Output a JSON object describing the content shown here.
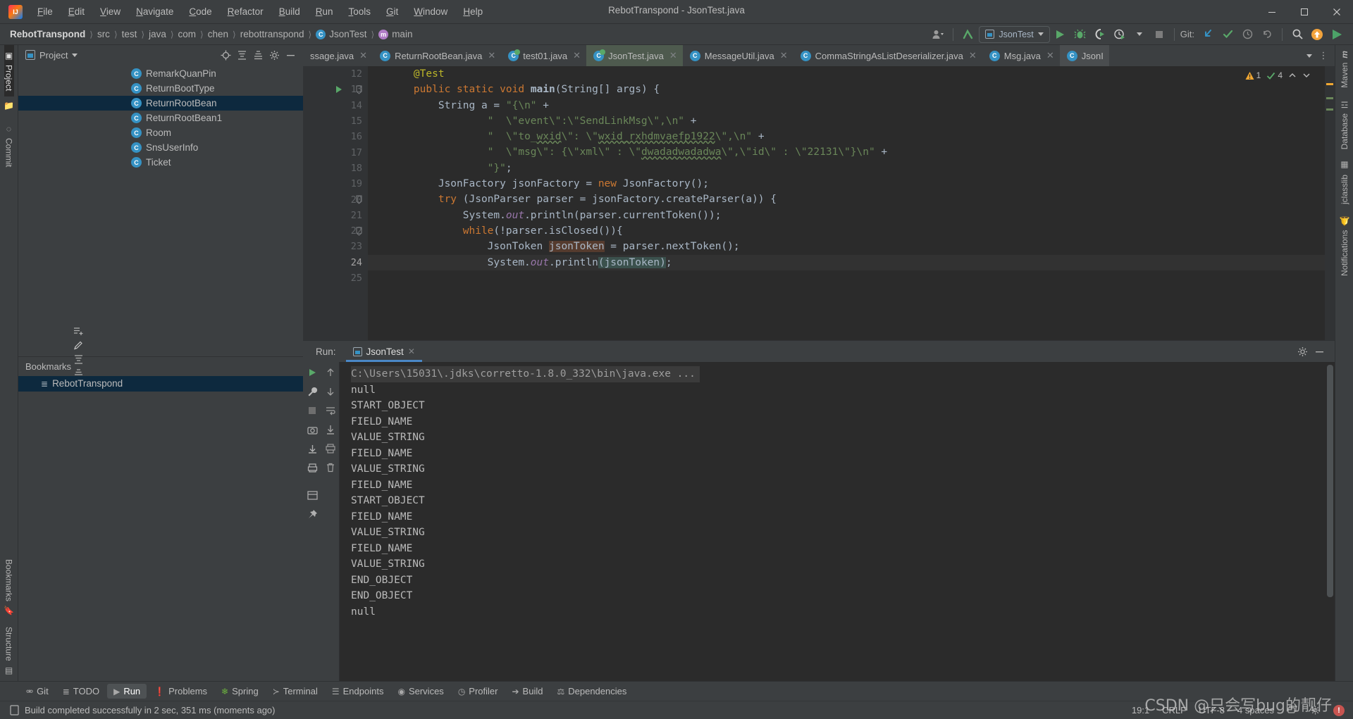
{
  "window": {
    "title": "RebotTranspond - JsonTest.java",
    "logo_icon": "intellij-idea-logo",
    "minimize_icon": "minimize-icon",
    "maximize_icon": "maximize-icon",
    "close_icon": "close-icon"
  },
  "menu": [
    {
      "label": "File",
      "mnemonic": "F"
    },
    {
      "label": "Edit",
      "mnemonic": "E"
    },
    {
      "label": "View",
      "mnemonic": "V"
    },
    {
      "label": "Navigate",
      "mnemonic": "N"
    },
    {
      "label": "Code",
      "mnemonic": "C"
    },
    {
      "label": "Refactor",
      "mnemonic": "R"
    },
    {
      "label": "Build",
      "mnemonic": "B"
    },
    {
      "label": "Run",
      "mnemonic": "R"
    },
    {
      "label": "Tools",
      "mnemonic": "T"
    },
    {
      "label": "Git",
      "mnemonic": "G"
    },
    {
      "label": "Window",
      "mnemonic": "W"
    },
    {
      "label": "Help",
      "mnemonic": "H"
    }
  ],
  "breadcrumb": [
    {
      "label": "RebotTranspond",
      "bold": true,
      "icon": ""
    },
    {
      "label": "src",
      "bold": false,
      "icon": ""
    },
    {
      "label": "test",
      "bold": false,
      "icon": ""
    },
    {
      "label": "java",
      "bold": false,
      "icon": ""
    },
    {
      "label": "com",
      "bold": false,
      "icon": ""
    },
    {
      "label": "chen",
      "bold": false,
      "icon": ""
    },
    {
      "label": "rebottranspond",
      "bold": false,
      "icon": ""
    },
    {
      "label": "JsonTest",
      "bold": false,
      "icon": "class-icon"
    },
    {
      "label": "main",
      "bold": false,
      "icon": "method-icon"
    }
  ],
  "toolbar": {
    "account_icon": "user-account-icon",
    "updates_icon": "update-arrow-icon",
    "run_config": "JsonTest",
    "run_config_icon": "application-config-icon",
    "run_icon": "run-icon",
    "debug_icon": "debug-bug-icon",
    "coverage_icon": "run-with-coverage-icon",
    "profiler_icon": "profiler-icon",
    "stop_icon": "stop-icon",
    "git_label": "Git:",
    "git_update_icon": "git-update-project-icon",
    "git_commit_icon": "git-commit-checkmark-icon",
    "git_history_icon": "git-history-clock-icon",
    "git_rollback_icon": "git-rollback-icon",
    "search_icon": "search-everywhere-icon",
    "notification_icon": "ide-update-icon",
    "run_anything_icon": "run-anything-icon"
  },
  "left_stripe": [
    {
      "label": "Project",
      "icon": "project-icon",
      "active": true
    },
    {
      "label": "",
      "icon": "folder-icon",
      "active": false
    },
    {
      "label": "Commit",
      "icon": "commit-icon",
      "active": false
    },
    {
      "label": "Bookmarks",
      "icon": "bookmarks-icon",
      "active": false
    },
    {
      "label": "Structure",
      "icon": "structure-icon",
      "active": false
    }
  ],
  "right_stripe": [
    {
      "label": "Maven",
      "icon": "maven-icon"
    },
    {
      "label": "Database",
      "icon": "database-icon"
    },
    {
      "label": "jclasslib",
      "icon": "jclasslib-icon"
    },
    {
      "label": "Notifications",
      "icon": "notifications-bell-icon"
    }
  ],
  "project_panel": {
    "title": "Project",
    "title_icon": "project-view-icon",
    "dropdown_icon": "chevron-down-icon",
    "actions": [
      "locate-icon",
      "expand-all-icon",
      "collapse-all-icon",
      "settings-gear-icon",
      "hide-icon"
    ],
    "tree_items": [
      {
        "label": "RemarkQuanPin",
        "icon": "java-class-icon",
        "selected": false
      },
      {
        "label": "ReturnBootType",
        "icon": "java-class-icon",
        "selected": false
      },
      {
        "label": "ReturnRootBean",
        "icon": "java-class-icon",
        "selected": true
      },
      {
        "label": "ReturnRootBean1",
        "icon": "java-class-icon",
        "selected": false
      },
      {
        "label": "Room",
        "icon": "java-class-icon",
        "selected": false
      },
      {
        "label": "SnsUserInfo",
        "icon": "java-class-icon",
        "selected": false
      },
      {
        "label": "Ticket",
        "icon": "java-class-icon",
        "selected": false
      }
    ]
  },
  "bookmarks_panel": {
    "title": "Bookmarks",
    "actions": [
      "add-bookmark-icon",
      "edit-icon",
      "expand-all-icon",
      "collapse-all-icon",
      "hide-icon"
    ],
    "items": [
      {
        "label": "RebotTranspond",
        "icon": "bookmark-list-icon",
        "selected": true
      }
    ]
  },
  "editor_tabs": [
    {
      "label": "ssage.java",
      "icon": "java-class-icon",
      "state": "normal",
      "close_icon": "close-tab-icon"
    },
    {
      "label": "ReturnRootBean.java",
      "icon": "java-class-icon",
      "state": "normal",
      "close_icon": "close-tab-icon"
    },
    {
      "label": "test01.java",
      "icon": "java-runnable-class-icon",
      "state": "runnable",
      "close_icon": "close-tab-icon"
    },
    {
      "label": "JsonTest.java",
      "icon": "java-runnable-class-icon",
      "state": "active",
      "close_icon": "close-tab-icon"
    },
    {
      "label": "MessageUtil.java",
      "icon": "java-class-icon",
      "state": "normal",
      "close_icon": "close-tab-icon"
    },
    {
      "label": "CommaStringAsListDeserializer.java",
      "icon": "java-class-icon",
      "state": "normal",
      "close_icon": "close-tab-icon"
    },
    {
      "label": "Msg.java",
      "icon": "java-class-icon",
      "state": "normal",
      "close_icon": "close-tab-icon"
    },
    {
      "label": "JsonI",
      "icon": "java-class-icon",
      "state": "normal",
      "close_icon": ""
    }
  ],
  "editor_tabs_actions": {
    "more_tabs_icon": "chevron-down-icon",
    "tab_options_icon": "more-vertical-icon"
  },
  "inspections": {
    "warning_count": "1",
    "warning_icon": "warning-triangle-icon",
    "ok_count": "4",
    "ok_icon": "checkmark-icon",
    "prev_icon": "chevron-up-icon",
    "next_icon": "chevron-down-icon"
  },
  "code": {
    "lines": [
      {
        "num": "12",
        "html": "    <span class=\"ann\">@Test</span>",
        "gutter": "",
        "current": false
      },
      {
        "num": "13",
        "html": "    <span class=\"kw\">public</span> <span class=\"kw\">static</span> <span class=\"kw\">void</span> <span class=\"mtd\">main</span>(String[] args) {",
        "gutter": "run-gutter-icon",
        "current": false
      },
      {
        "num": "14",
        "html": "        String a = <span class=\"str\">\"{\\n\"</span> +",
        "gutter": "",
        "current": false
      },
      {
        "num": "15",
        "html": "                <span class=\"str\">\"  \\\"event\\\":\\\"SendLinkMsg\\\",\\n\"</span> +",
        "gutter": "",
        "current": false
      },
      {
        "num": "16",
        "html": "                <span class=\"str\">\"  \\\"to_<span class=\"err-wavy\">wxid</span>\\\": \\\"<span class=\"err-wavy\">wxid_rxhdmvaefp1922</span>\\\",\\n\"</span> +",
        "gutter": "",
        "current": false
      },
      {
        "num": "17",
        "html": "                <span class=\"str\">\"  \\\"msg\\\": {\\\"xml\\\" : \\\"<span class=\"err-wavy\">dwadadwadadwa</span>\\\",\\\"id\\\" : \\\"22131\\\"}\\n\"</span> +",
        "gutter": "",
        "current": false
      },
      {
        "num": "18",
        "html": "                <span class=\"str\">\"}\"</span>;",
        "gutter": "",
        "current": false
      },
      {
        "num": "19",
        "html": "        JsonFactory jsonFactory = <span class=\"kw\">new</span> JsonFactory();",
        "gutter": "",
        "current": false
      },
      {
        "num": "20",
        "html": "        <span class=\"kw\">try</span> (JsonParser parser = jsonFactory.createParser(a)) {",
        "gutter": "fold-icon",
        "current": false
      },
      {
        "num": "21",
        "html": "            System.<span class=\"fld\">out</span>.println(parser.currentToken());",
        "gutter": "",
        "current": false
      },
      {
        "num": "22",
        "html": "            <span class=\"kw\">while</span>(!parser.isClosed()){",
        "gutter": "fold-icon",
        "current": false
      },
      {
        "num": "23",
        "html": "                JsonToken <span class=\"hl-i\">jsonToken</span> = parser.nextToken();",
        "gutter": "",
        "current": false
      },
      {
        "num": "24",
        "html": "                System.<span class=\"fld\">out</span>.println<span class=\"hl-w\">(jsonToken)</span>;",
        "gutter": "",
        "current": true
      },
      {
        "num": "25",
        "html": "",
        "gutter": "",
        "current": false
      }
    ]
  },
  "run_window": {
    "label": "Run:",
    "tab": "JsonTest",
    "tab_icon": "application-config-icon",
    "tab_close_icon": "close-tab-icon",
    "settings_icon": "settings-gear-icon",
    "hide_icon": "hide-icon",
    "side_actions": [
      "rerun-icon",
      "wrench-settings-icon",
      "stop-icon",
      "camera-icon",
      "thread-dump-icon",
      "export-icon",
      "layout-icon",
      "pin-icon"
    ],
    "side_actions2": [
      "scroll-up-icon",
      "scroll-down-icon",
      "soft-wrap-icon",
      "scroll-to-end-icon",
      "print-icon",
      "trash-icon"
    ],
    "console": [
      {
        "text": "C:\\Users\\15031\\.jdks\\corretto-1.8.0_332\\bin\\java.exe ...",
        "kind": "cmd"
      },
      {
        "text": "null",
        "kind": "out"
      },
      {
        "text": "START_OBJECT",
        "kind": "out"
      },
      {
        "text": "FIELD_NAME",
        "kind": "out"
      },
      {
        "text": "VALUE_STRING",
        "kind": "out"
      },
      {
        "text": "FIELD_NAME",
        "kind": "out"
      },
      {
        "text": "VALUE_STRING",
        "kind": "out"
      },
      {
        "text": "FIELD_NAME",
        "kind": "out"
      },
      {
        "text": "START_OBJECT",
        "kind": "out"
      },
      {
        "text": "FIELD_NAME",
        "kind": "out"
      },
      {
        "text": "VALUE_STRING",
        "kind": "out"
      },
      {
        "text": "FIELD_NAME",
        "kind": "out"
      },
      {
        "text": "VALUE_STRING",
        "kind": "out"
      },
      {
        "text": "END_OBJECT",
        "kind": "out"
      },
      {
        "text": "END_OBJECT",
        "kind": "out"
      },
      {
        "text": "null",
        "kind": "out"
      }
    ]
  },
  "bottom_tabs": [
    {
      "label": "Git",
      "icon": "git-branch-icon",
      "active": false
    },
    {
      "label": "TODO",
      "icon": "todo-list-icon",
      "active": false
    },
    {
      "label": "Run",
      "icon": "run-icon",
      "active": true
    },
    {
      "label": "Problems",
      "icon": "problems-icon",
      "active": false
    },
    {
      "label": "Spring",
      "icon": "spring-leaf-icon",
      "active": false
    },
    {
      "label": "Terminal",
      "icon": "terminal-icon",
      "active": false
    },
    {
      "label": "Endpoints",
      "icon": "endpoints-icon",
      "active": false
    },
    {
      "label": "Services",
      "icon": "services-icon",
      "active": false
    },
    {
      "label": "Profiler",
      "icon": "profiler-icon",
      "active": false
    },
    {
      "label": "Build",
      "icon": "build-hammer-icon",
      "active": false
    },
    {
      "label": "Dependencies",
      "icon": "dependencies-icon",
      "active": false
    }
  ],
  "statusbar": {
    "message_icon": "build-status-icon",
    "message": "Build completed successfully in 2 sec, 351 ms (moments ago)",
    "caret": "19:1",
    "line_separator": "CRLF",
    "encoding": "UTF-8",
    "indent": "4 spaces",
    "branch_icon": "git-branch-status-icon",
    "inspection_icon": "inspection-gear-icon",
    "error_badge": "!",
    "watermark": "CSDN @只会写bug的靓仔"
  },
  "colors": {
    "accent_blue": "#3592c4",
    "run_green": "#59a869",
    "selection": "#0d293e",
    "editor_bg": "#2b2b2b",
    "panel_bg": "#3c3f41",
    "string_green": "#6a8759",
    "keyword_orange": "#cc7832"
  }
}
